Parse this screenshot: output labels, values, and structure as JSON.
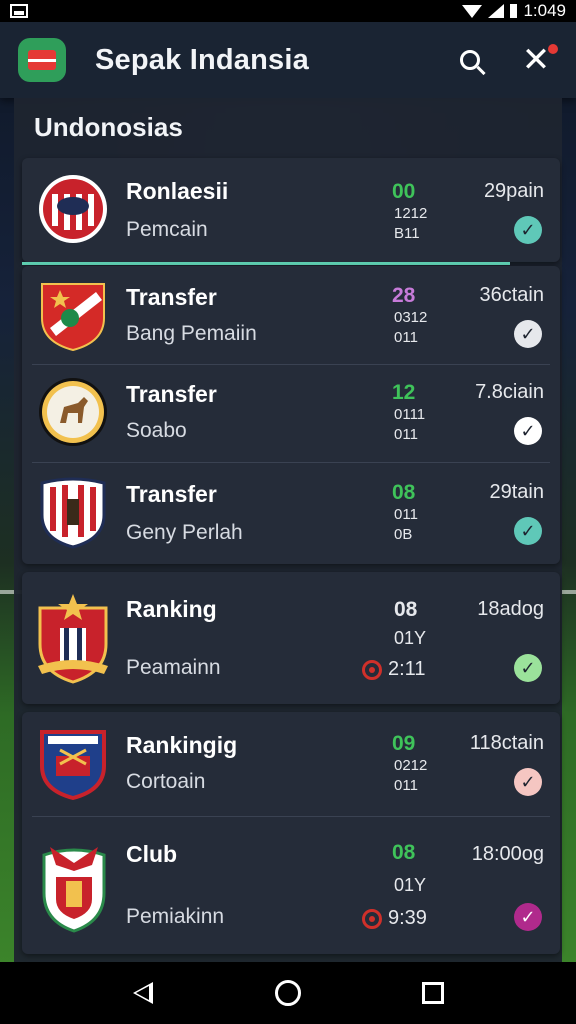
{
  "status_bar": {
    "time": "1:049"
  },
  "app_bar": {
    "title": "Sepak Indansia"
  },
  "section": {
    "title": "Undonosias"
  },
  "rows": [
    {
      "title": "Ronlaesii",
      "subtitle": "Pemcain",
      "score": "00",
      "score_color": "#3fc35a",
      "mini_top": "1212",
      "mini_bottom": "B11",
      "right_label": "29pain",
      "check_color": "#5fc8b8",
      "crest": "crest-red-white-stripes-icon"
    },
    {
      "title": "Transfer",
      "subtitle": "Bang Pemaiin",
      "score": "28",
      "score_color": "#c77bd9",
      "mini_top": "0312",
      "mini_bottom": "011",
      "right_label": "36ctain",
      "check_color": "#e6e8ec",
      "crest": "crest-red-shield-icon"
    },
    {
      "title": "Transfer",
      "subtitle": "Soabo",
      "score": "12",
      "score_color": "#3fc35a",
      "mini_top": "0111",
      "mini_bottom": "011",
      "right_label": "7.8ciain",
      "check_color": "#ffffff",
      "crest": "crest-dog-icon"
    },
    {
      "title": "Transfer",
      "subtitle": "Geny Perlah",
      "score": "08",
      "score_color": "#3fc35a",
      "mini_top": "011",
      "mini_bottom": "0B",
      "right_label": "29tain",
      "check_color": "#5fc8b8",
      "crest": "crest-striped-shield-icon"
    },
    {
      "title": "Ranking",
      "subtitle": "Peamainn",
      "score": "08",
      "score_color": "#e6e8ec",
      "mini_top": "01Y",
      "clock": "2:11",
      "right_label": "18adog",
      "check_color": "#9be29b",
      "crest": "crest-star-shield-icon"
    },
    {
      "title": "Rankingig",
      "subtitle": "Cortoain",
      "score": "09",
      "score_color": "#3fc35a",
      "mini_top": "0212",
      "mini_bottom": "011",
      "right_label": "118ctain",
      "check_color": "#f5c6c2",
      "crest": "crest-blue-red-shield-icon"
    },
    {
      "title": "Club",
      "subtitle": "Pemiakinn",
      "score": "08",
      "score_color": "#3fc35a",
      "mini_top": "01Y",
      "clock": "9:39",
      "right_label": "18:00og",
      "check_color": "#b02a8c",
      "crest": "crest-eagle-icon"
    }
  ]
}
